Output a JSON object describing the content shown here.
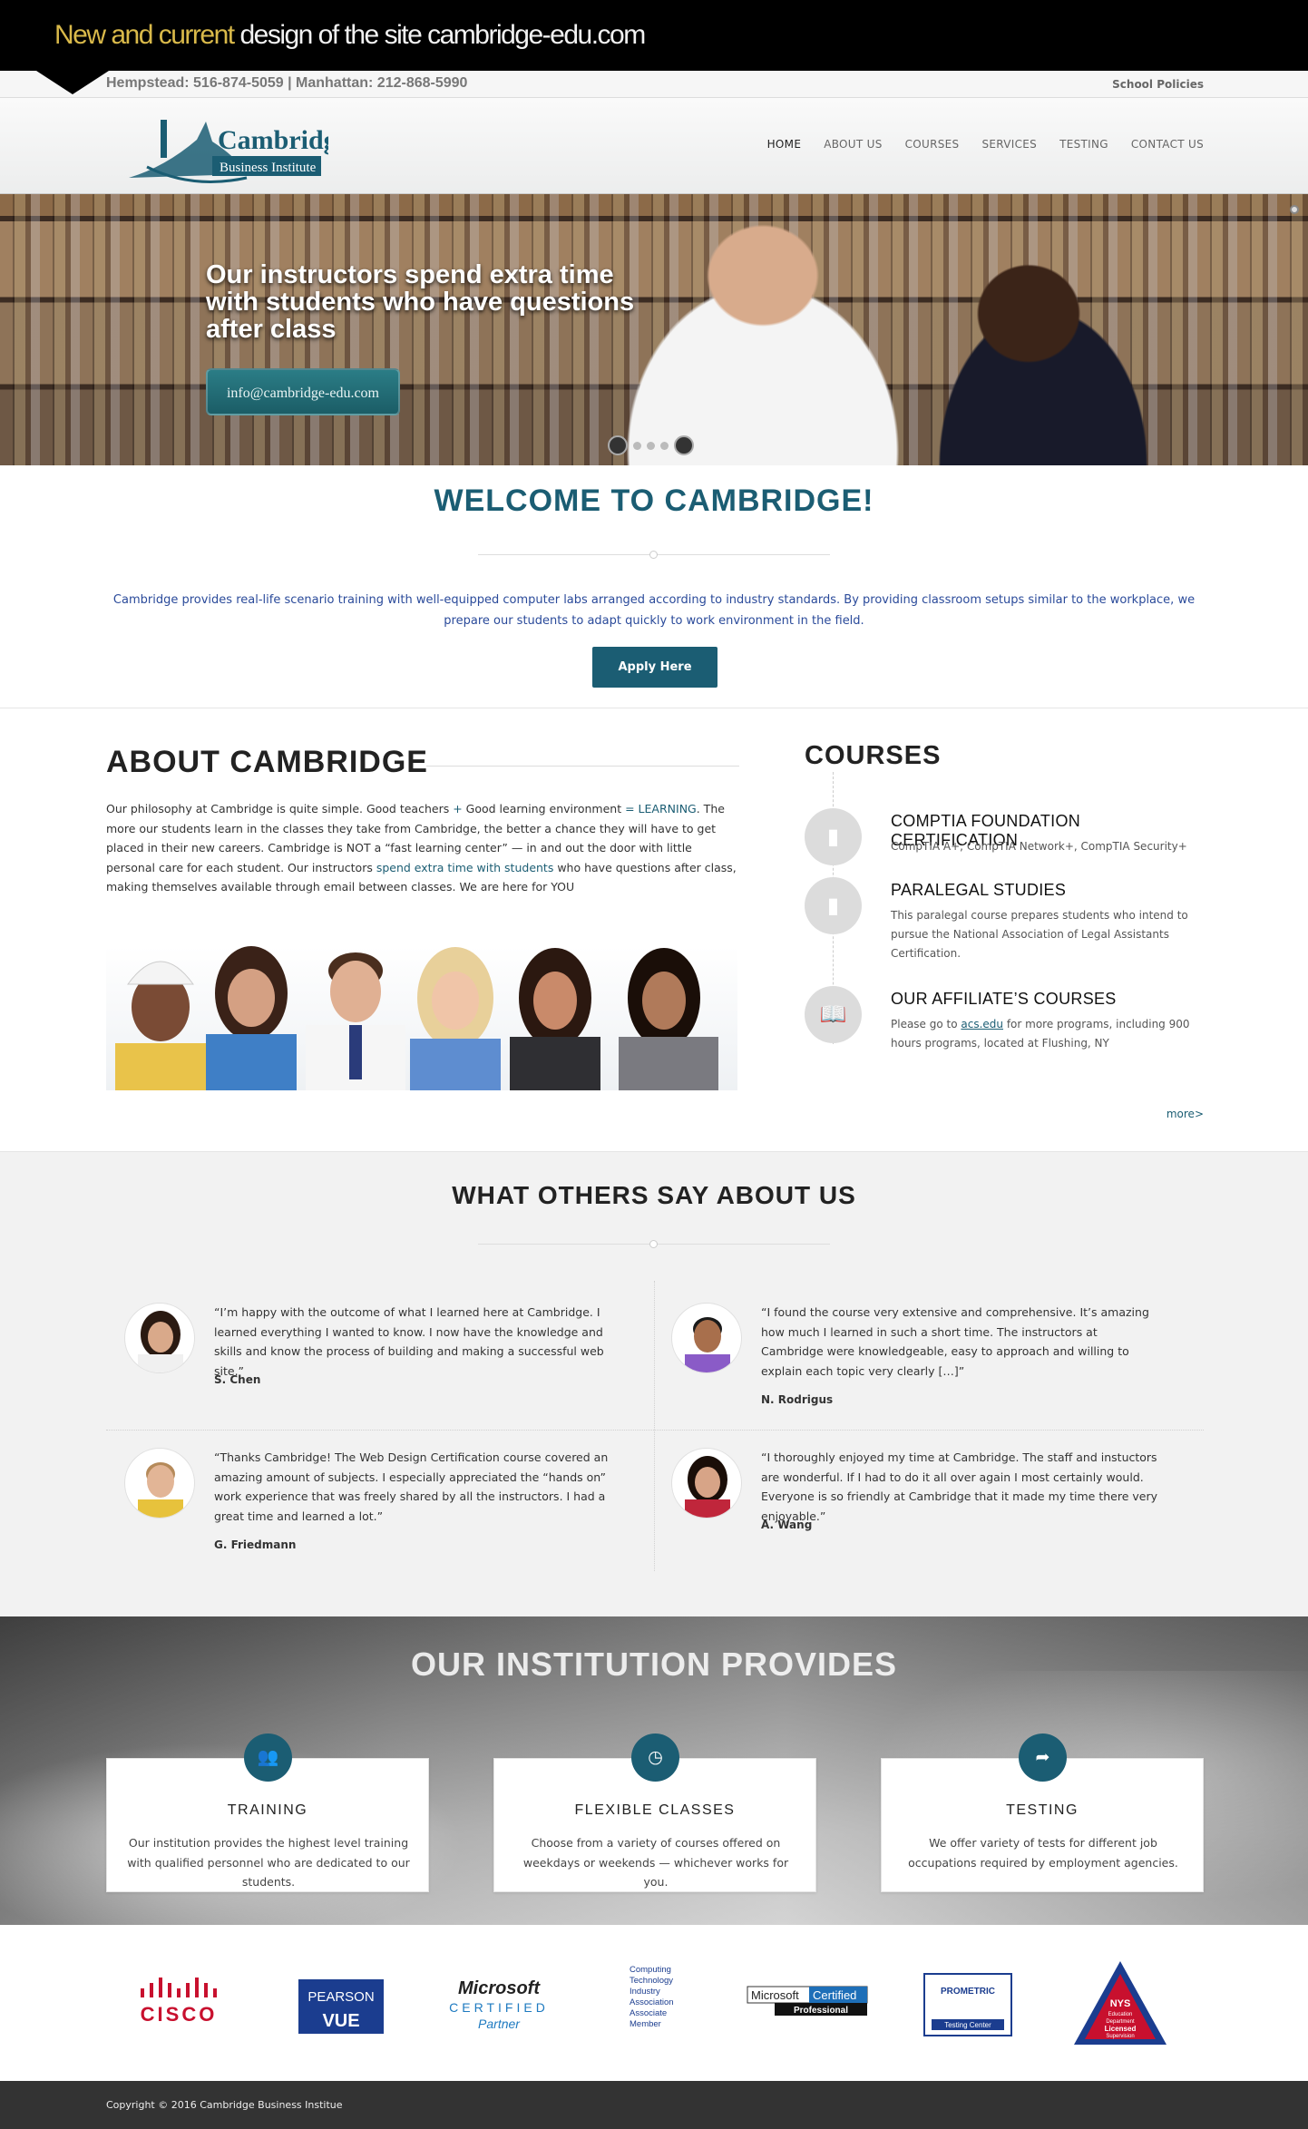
{
  "banner": {
    "highlight": "New and current",
    "rest": " design of the site cambridge-edu.com"
  },
  "topbar": {
    "phones": "Hempstead: 516-874-5059 | Manhattan: 212-868-5990",
    "policies": "School Policies"
  },
  "logo": {
    "name": "Cambridge",
    "sub": "Business Institute"
  },
  "nav": [
    {
      "label": "HOME"
    },
    {
      "label": "ABOUT US"
    },
    {
      "label": "COURSES"
    },
    {
      "label": "SERVICES"
    },
    {
      "label": "TESTING"
    },
    {
      "label": "CONTACT US"
    }
  ],
  "hero": {
    "title": "Our instructors spend extra time with students who have questions after class",
    "email_button": "info@cambridge-edu.com"
  },
  "welcome": {
    "title": "WELCOME TO CAMBRIDGE!",
    "text": "Cambridge provides real-life scenario training with well-equipped computer labs arranged according to industry standards. By providing classroom setups similar to the workplace, we prepare our students to adapt quickly to work environment in the field.",
    "apply_button": "Apply Here"
  },
  "about": {
    "title": "ABOUT CAMBRIDGE",
    "p1": "Our philosophy at Cambridge is quite simple. Good teachers ",
    "plus": "+",
    "p2": " Good learning environment ",
    "eq": "= LEARNING",
    "p3": ". The more our students learn in the classes they take from Cambridge, the better a chance they will have to get placed in their new careers. Cambridge is NOT a “fast learning center” — in and out the door with little personal care for each student. Our instructors ",
    "hl2": "spend extra time with students",
    "p4": " who have questions after class, making themselves available through email between classes. We are here for YOU"
  },
  "courses": {
    "title": "COURSES",
    "items": [
      {
        "title": "COMPTIA FOUNDATION CERTIFICATION",
        "desc": "CompTIA A+, CompTIA Network+, CompTIA Security+",
        "icon": "book-icon"
      },
      {
        "title": "PARALEGAL STUDIES",
        "desc": "This paralegal course prepares students who intend to pursue the National Association of Legal Assistants Certification.",
        "icon": "book-icon"
      },
      {
        "title": "OUR AFFILIATE’S COURSES",
        "desc_pre": "Please go to ",
        "desc_link": "acs.edu",
        "desc_post": " for more programs, including 900 hours programs, located at Flushing, NY",
        "icon": "open-book-icon"
      }
    ],
    "more": "more>"
  },
  "testimonials": {
    "title": "WHAT OTHERS SAY ABOUT US",
    "items": [
      {
        "quote": "“I’m happy with the outcome of what I learned here at Cambridge. I learned everything I wanted to know. I now have the knowledge and skills and know the process of building and making a successful web site.”",
        "author": "S. Chen"
      },
      {
        "quote": "“I found the course very extensive and comprehensive. It’s amazing how much I learned in such a short time. The instructors at Cambridge were knowledgeable, easy to approach and willing to explain each topic very clearly […]”",
        "author": "N. Rodrigus"
      },
      {
        "quote": "“Thanks Cambridge! The Web Design Certification course covered an amazing amount of subjects. I especially appreciated the “hands on” work experience that was freely shared by all the instructors. I had a great time and learned a lot.”",
        "author": "G. Friedmann"
      },
      {
        "quote": "“I thoroughly enjoyed my time at Cambridge. The staff and instuctors are wonderful. If I had to do it all over again I most certainly would. Everyone is so friendly at Cambridge that it made my time there very enjoyable.”",
        "author": "A. Wang"
      }
    ]
  },
  "institution": {
    "title": "OUR INSTITUTION PROVIDES",
    "cards": [
      {
        "title": "TRAINING",
        "text": "Our institution provides the highest level training with qualified personnel who are dedicated to our students.",
        "icon": "users-icon"
      },
      {
        "title": "FLEXIBLE CLASSES",
        "text": "Choose from a variety of courses offered on weekdays or weekends — whichever works for you.",
        "icon": "clock-icon"
      },
      {
        "title": "TESTING",
        "text": "We offer variety of tests for different job occupations required by employment agencies.",
        "icon": "share-icon"
      }
    ]
  },
  "partners": {
    "cisco": "CISCO",
    "pearson_top": "PEARSON",
    "pearson_bottom": "VUE",
    "ms_main": "Microsoft",
    "ms_cert": "CERTIFIED",
    "ms_partner": "Partner",
    "ctia": [
      "Computing",
      "Technology",
      "Industry",
      "Association",
      "Associate",
      "Member"
    ],
    "mcp_ms": "Microsoft",
    "mcp_cert": "Certified",
    "mcp_pro": "Professional",
    "prometric": "PROMETRIC",
    "prometric_sub": "Testing Center",
    "nys": [
      "NYS",
      "Education",
      "Department",
      "Licensed",
      "Supervision"
    ]
  },
  "footer": {
    "copyright": "Copyright © 2016 Cambridge Business Institue"
  },
  "colors": {
    "accent": "#1b5d73",
    "banner_highlight": "#d9b94a",
    "footer": "#333333"
  }
}
